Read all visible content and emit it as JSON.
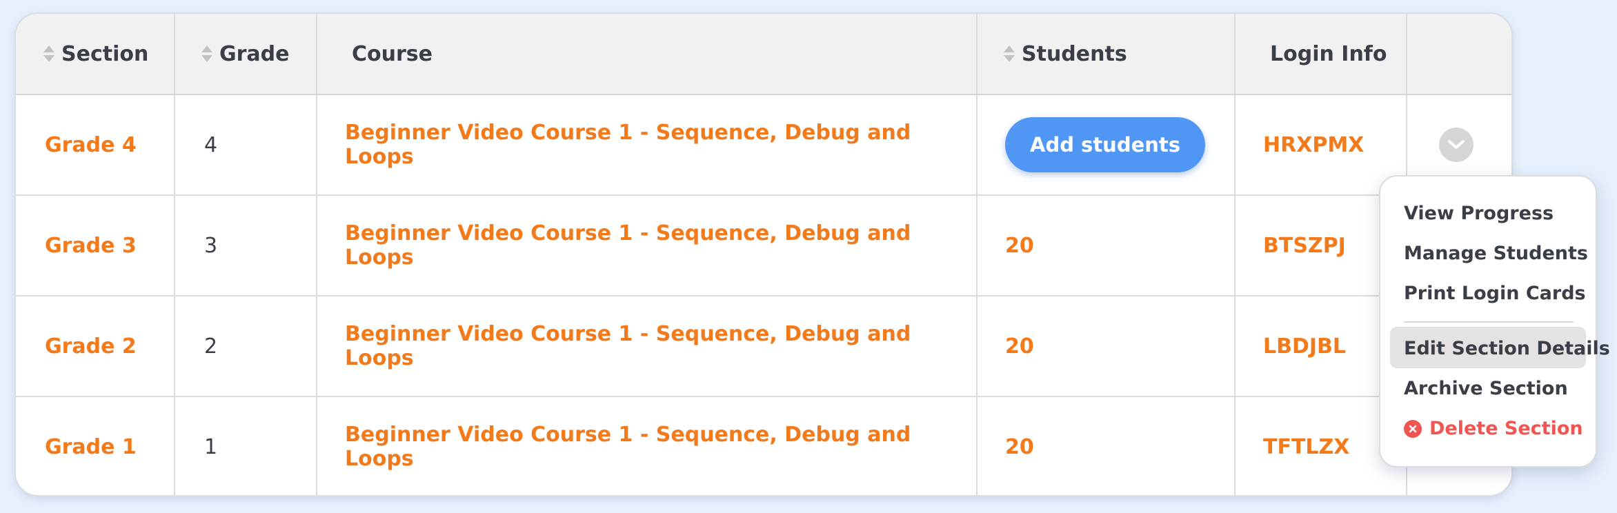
{
  "table": {
    "headers": {
      "section": "Section",
      "grade": "Grade",
      "course": "Course",
      "students": "Students",
      "login_info": "Login Info"
    },
    "rows": [
      {
        "section": "Grade 4",
        "grade": "4",
        "course": "Beginner Video Course 1 - Sequence, Debug and Loops",
        "students_button": "Add students",
        "login": "HRXPMX"
      },
      {
        "section": "Grade 3",
        "grade": "3",
        "course": "Beginner Video Course 1 - Sequence, Debug and Loops",
        "students": "20",
        "login": "BTSZPJ"
      },
      {
        "section": "Grade 2",
        "grade": "2",
        "course": "Beginner Video Course 1 - Sequence, Debug and Loops",
        "students": "20",
        "login": "LBDJBL"
      },
      {
        "section": "Grade 1",
        "grade": "1",
        "course": "Beginner Video Course 1 - Sequence, Debug and Loops",
        "students": "20",
        "login": "TFTLZX"
      }
    ]
  },
  "dropdown": {
    "items": [
      "View Progress",
      "Manage Students",
      "Print Login Cards"
    ],
    "edit": "Edit Section Details",
    "archive": "Archive Section",
    "delete": "Delete Section"
  },
  "colors": {
    "accent_orange": "#f27a1a",
    "button_blue": "#4f96f5",
    "danger_red": "#f05552",
    "page_background": "#e7f0fd"
  },
  "icons": {
    "sort": "sort-updown-icon",
    "row_menu": "chevron-down-icon",
    "delete": "x-circle-icon"
  }
}
